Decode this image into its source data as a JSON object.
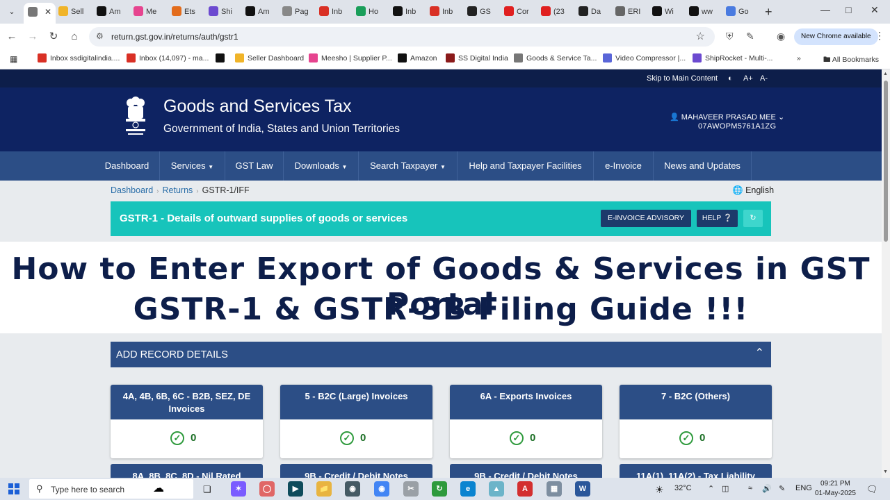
{
  "browser": {
    "tabs": [
      {
        "label": "",
        "icon": "gst-emblem-icon",
        "color": "#777777",
        "active": true
      },
      {
        "label": "Sell",
        "icon": "seller-icon",
        "color": "#f0b429"
      },
      {
        "label": "Am",
        "icon": "amazon-icon",
        "color": "#111111"
      },
      {
        "label": "Me",
        "icon": "meesho-icon",
        "color": "#e6448f"
      },
      {
        "label": "Ets",
        "icon": "etsy-icon",
        "color": "#e36c1c"
      },
      {
        "label": "Shi",
        "icon": "shiprocket-icon",
        "color": "#6c4ad0"
      },
      {
        "label": "Am",
        "icon": "amazon-icon",
        "color": "#111111"
      },
      {
        "label": "Pag",
        "icon": "page-icon",
        "color": "#888888"
      },
      {
        "label": "Inb",
        "icon": "gmail-icon",
        "color": "#d93025"
      },
      {
        "label": "Ho",
        "icon": "drive-icon",
        "color": "#1a9e5a"
      },
      {
        "label": "Inb",
        "icon": "wix-icon",
        "color": "#111111"
      },
      {
        "label": "Inb",
        "icon": "gmail-icon",
        "color": "#d93025"
      },
      {
        "label": "GS",
        "icon": "gs-icon",
        "color": "#222222"
      },
      {
        "label": "Cor",
        "icon": "youtube-icon",
        "color": "#e02020"
      },
      {
        "label": "(23",
        "icon": "youtube-icon",
        "color": "#e02020"
      },
      {
        "label": "Da",
        "icon": "da-icon",
        "color": "#222222"
      },
      {
        "label": "ERI",
        "icon": "globe-icon",
        "color": "#666666"
      },
      {
        "label": "Wi",
        "icon": "wix-icon",
        "color": "#111111"
      },
      {
        "label": "ww",
        "icon": "ww-icon",
        "color": "#111111"
      },
      {
        "label": "Go",
        "icon": "translate-icon",
        "color": "#4a7be0"
      }
    ],
    "url": "return.gst.gov.in/returns/auth/gstr1",
    "update_label": "New Chrome available",
    "bookmarks": [
      {
        "label": "Inbox ssdigitalindia....",
        "icon": "gmail-icon",
        "color": "#d93025"
      },
      {
        "label": "Inbox (14,097) - ma...",
        "icon": "gmail-icon",
        "color": "#d93025"
      },
      {
        "label": "",
        "icon": "amazon-icon",
        "color": "#111111"
      },
      {
        "label": "Seller Dashboard",
        "icon": "seller-icon",
        "color": "#f0b429"
      },
      {
        "label": "Meesho | Supplier P...",
        "icon": "meesho-icon",
        "color": "#e6448f"
      },
      {
        "label": "Amazon",
        "icon": "amazon-icon",
        "color": "#111111"
      },
      {
        "label": "SS Digital India",
        "icon": "ssd-icon",
        "color": "#8b1a1a"
      },
      {
        "label": "Goods & Service Ta...",
        "icon": "gst-emblem-icon",
        "color": "#777777"
      },
      {
        "label": "Video Compressor |...",
        "icon": "video-compressor-icon",
        "color": "#5a66d8"
      },
      {
        "label": "ShipRocket - Multi-...",
        "icon": "shiprocket-icon",
        "color": "#6c4ad0"
      }
    ],
    "all_bookmarks": "All Bookmarks"
  },
  "gst": {
    "skip": "Skip to Main Content",
    "font_up": "A+",
    "font_down": "A-",
    "title": "Goods and Services Tax",
    "subtitle": "Government of India, States and Union Territories",
    "user_name": "MAHAVEER PRASAD MEE",
    "gstin": "07AWOPM5761A1ZG",
    "nav": [
      "Dashboard",
      "Services",
      "GST Law",
      "Downloads",
      "Search Taxpayer",
      "Help and Taxpayer Facilities",
      "e-Invoice",
      "News and Updates"
    ],
    "breadcrumb": [
      "Dashboard",
      "Returns",
      "GSTR-1/IFF"
    ],
    "language": "English",
    "section_title": "GSTR-1 - Details of outward supplies of goods or services",
    "btn_advisory": "E-INVOICE ADVISORY",
    "btn_help": "HELP",
    "add_record": "ADD RECORD DETAILS",
    "cards": [
      {
        "title": "4A, 4B, 6B, 6C - B2B, SEZ, DE Invoices",
        "count": "0"
      },
      {
        "title": "5 - B2C (Large) Invoices",
        "count": "0"
      },
      {
        "title": "6A - Exports Invoices",
        "count": "0"
      },
      {
        "title": "7 - B2C (Others)",
        "count": "0"
      }
    ],
    "cards_row2": [
      "8A, 8B, 8C, 8D - Nil Rated",
      "9B - Credit / Debit Notes",
      "9B - Credit / Debit Notes",
      "11A(1), 11A(2) - Tax Liability"
    ]
  },
  "overlay": {
    "line1": "How to Enter Export of Goods & Services in GST Portal",
    "line2": "GSTR-1 & GSTR-3B Filing Guide !!!"
  },
  "taskbar": {
    "search_placeholder": "Type here to search",
    "temperature": "32°C",
    "language": "ENG",
    "time": "09:21 PM",
    "date": "01-May-2025"
  }
}
